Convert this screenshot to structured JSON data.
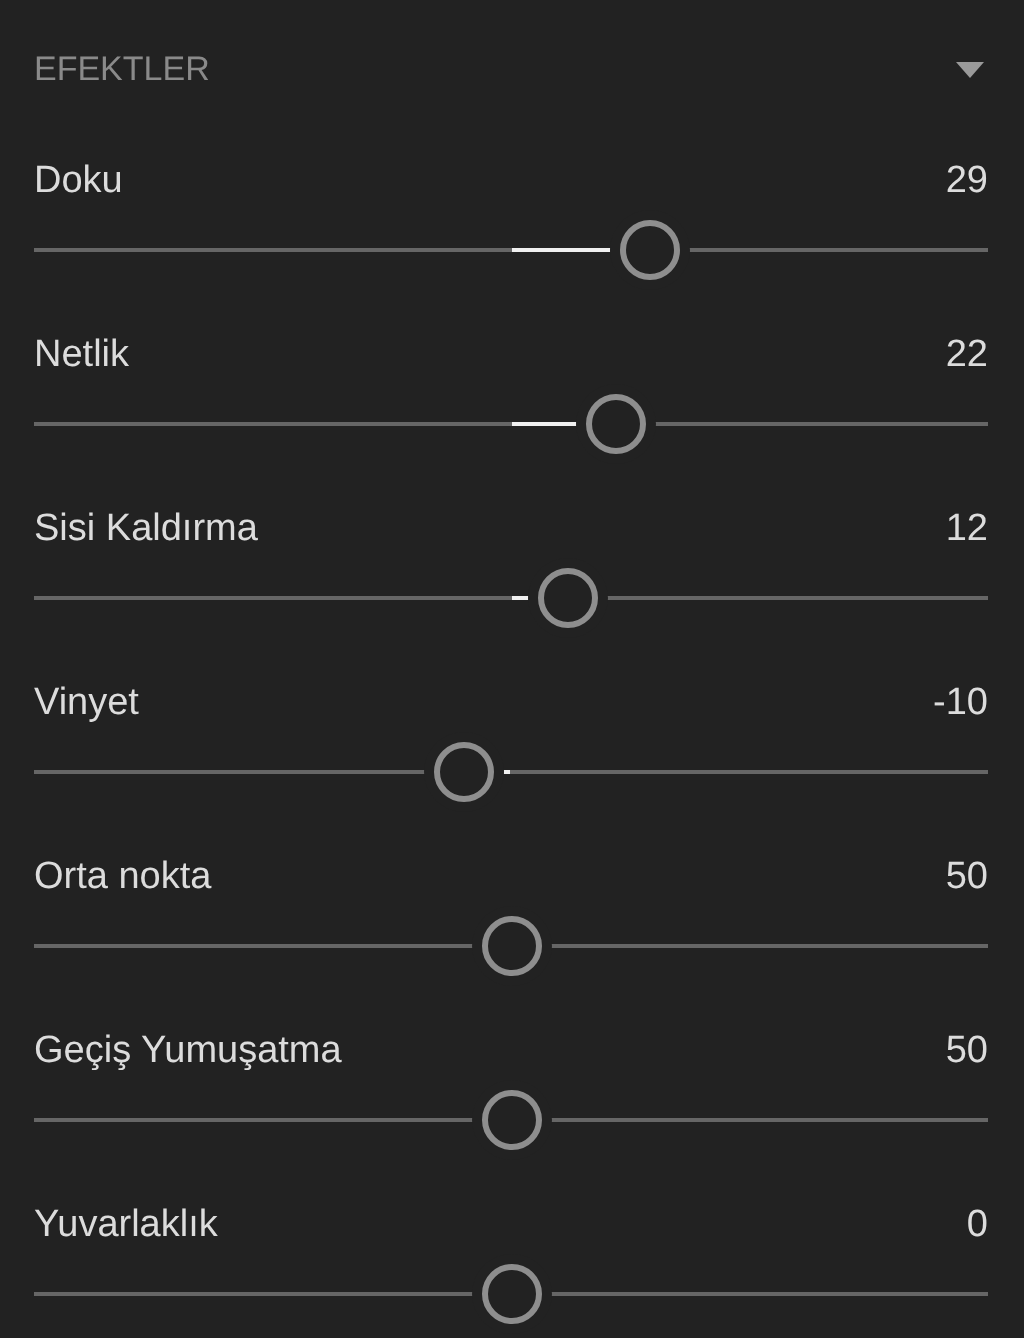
{
  "panel": {
    "title": "EFEKTLER",
    "expanded": true
  },
  "sliders": [
    {
      "label": "Doku",
      "value": "29",
      "level": 0.645
    },
    {
      "label": "Netlik",
      "value": "22",
      "level": 0.61
    },
    {
      "label": "Sisi Kaldırma",
      "value": "12",
      "level": 0.56
    },
    {
      "label": "Vinyet",
      "value": "-10",
      "level": 0.45
    },
    {
      "label": "Orta nokta",
      "value": "50",
      "level": 0.5
    },
    {
      "label": "Geçiş Yumuşatma",
      "value": "50",
      "level": 0.5
    },
    {
      "label": "Yuvarlaklık",
      "value": "0",
      "level": 0.5
    }
  ]
}
